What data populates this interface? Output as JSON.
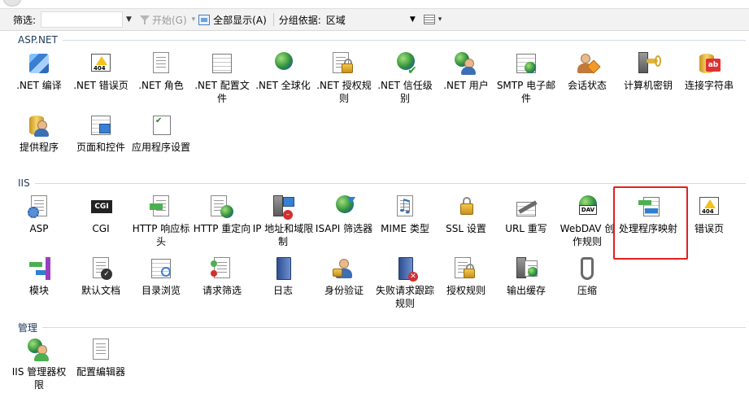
{
  "toolbar": {
    "filter_label": "筛选:",
    "filter_value": "",
    "start_label": "开始(G)",
    "show_all_label": "全部显示(A)",
    "group_by_label": "分组依据:",
    "group_by_value": "区域"
  },
  "groups": [
    {
      "title": "ASP.NET",
      "items": [
        {
          "label": ".NET 编译",
          "icon": "net-compile-icon"
        },
        {
          "label": ".NET 错误页",
          "icon": "net-error-pages-icon"
        },
        {
          "label": ".NET 角色",
          "icon": "net-roles-icon"
        },
        {
          "label": ".NET 配置文件",
          "icon": "net-profile-icon"
        },
        {
          "label": ".NET 全球化",
          "icon": "net-globalization-icon"
        },
        {
          "label": ".NET 授权规则",
          "icon": "net-authorization-rules-icon"
        },
        {
          "label": ".NET 信任级别",
          "icon": "net-trust-levels-icon"
        },
        {
          "label": ".NET 用户",
          "icon": "net-users-icon"
        },
        {
          "label": "SMTP 电子邮件",
          "icon": "smtp-email-icon"
        },
        {
          "label": "会话状态",
          "icon": "session-state-icon"
        },
        {
          "label": "计算机密钥",
          "icon": "machine-key-icon"
        },
        {
          "label": "连接字符串",
          "icon": "connection-strings-icon"
        },
        {
          "label": "提供程序",
          "icon": "providers-icon"
        },
        {
          "label": "页面和控件",
          "icon": "pages-controls-icon"
        },
        {
          "label": "应用程序设置",
          "icon": "app-settings-icon"
        }
      ]
    },
    {
      "title": "IIS",
      "items": [
        {
          "label": "ASP",
          "icon": "asp-icon"
        },
        {
          "label": "CGI",
          "icon": "cgi-icon"
        },
        {
          "label": "HTTP 响应标头",
          "icon": "http-response-headers-icon"
        },
        {
          "label": "HTTP 重定向",
          "icon": "http-redirect-icon"
        },
        {
          "label": "IP 地址和域限制",
          "icon": "ip-domain-restrictions-icon"
        },
        {
          "label": "ISAPI 筛选器",
          "icon": "isapi-filters-icon"
        },
        {
          "label": "MIME 类型",
          "icon": "mime-types-icon"
        },
        {
          "label": "SSL 设置",
          "icon": "ssl-settings-icon"
        },
        {
          "label": "URL 重写",
          "icon": "url-rewrite-icon"
        },
        {
          "label": "WebDAV 创作规则",
          "icon": "webdav-authoring-icon"
        },
        {
          "label": "处理程序映射",
          "icon": "handler-mappings-icon"
        },
        {
          "label": "错误页",
          "icon": "error-pages-icon"
        },
        {
          "label": "模块",
          "icon": "modules-icon"
        },
        {
          "label": "默认文档",
          "icon": "default-document-icon"
        },
        {
          "label": "目录浏览",
          "icon": "directory-browsing-icon"
        },
        {
          "label": "请求筛选",
          "icon": "request-filtering-icon"
        },
        {
          "label": "日志",
          "icon": "logging-icon"
        },
        {
          "label": "身份验证",
          "icon": "authentication-icon"
        },
        {
          "label": "失败请求跟踪规则",
          "icon": "failed-request-tracing-icon"
        },
        {
          "label": "授权规则",
          "icon": "authorization-rules-icon"
        },
        {
          "label": "输出缓存",
          "icon": "output-caching-icon"
        },
        {
          "label": "压缩",
          "icon": "compression-icon"
        }
      ]
    },
    {
      "title": "管理",
      "items": [
        {
          "label": "IIS 管理器权限",
          "icon": "iis-manager-permissions-icon"
        },
        {
          "label": "配置编辑器",
          "icon": "configuration-editor-icon"
        }
      ]
    }
  ],
  "colors": {
    "highlight": "#e3201b",
    "group_header_text": "#1e395b",
    "group_rule": "#d2dbe7"
  }
}
